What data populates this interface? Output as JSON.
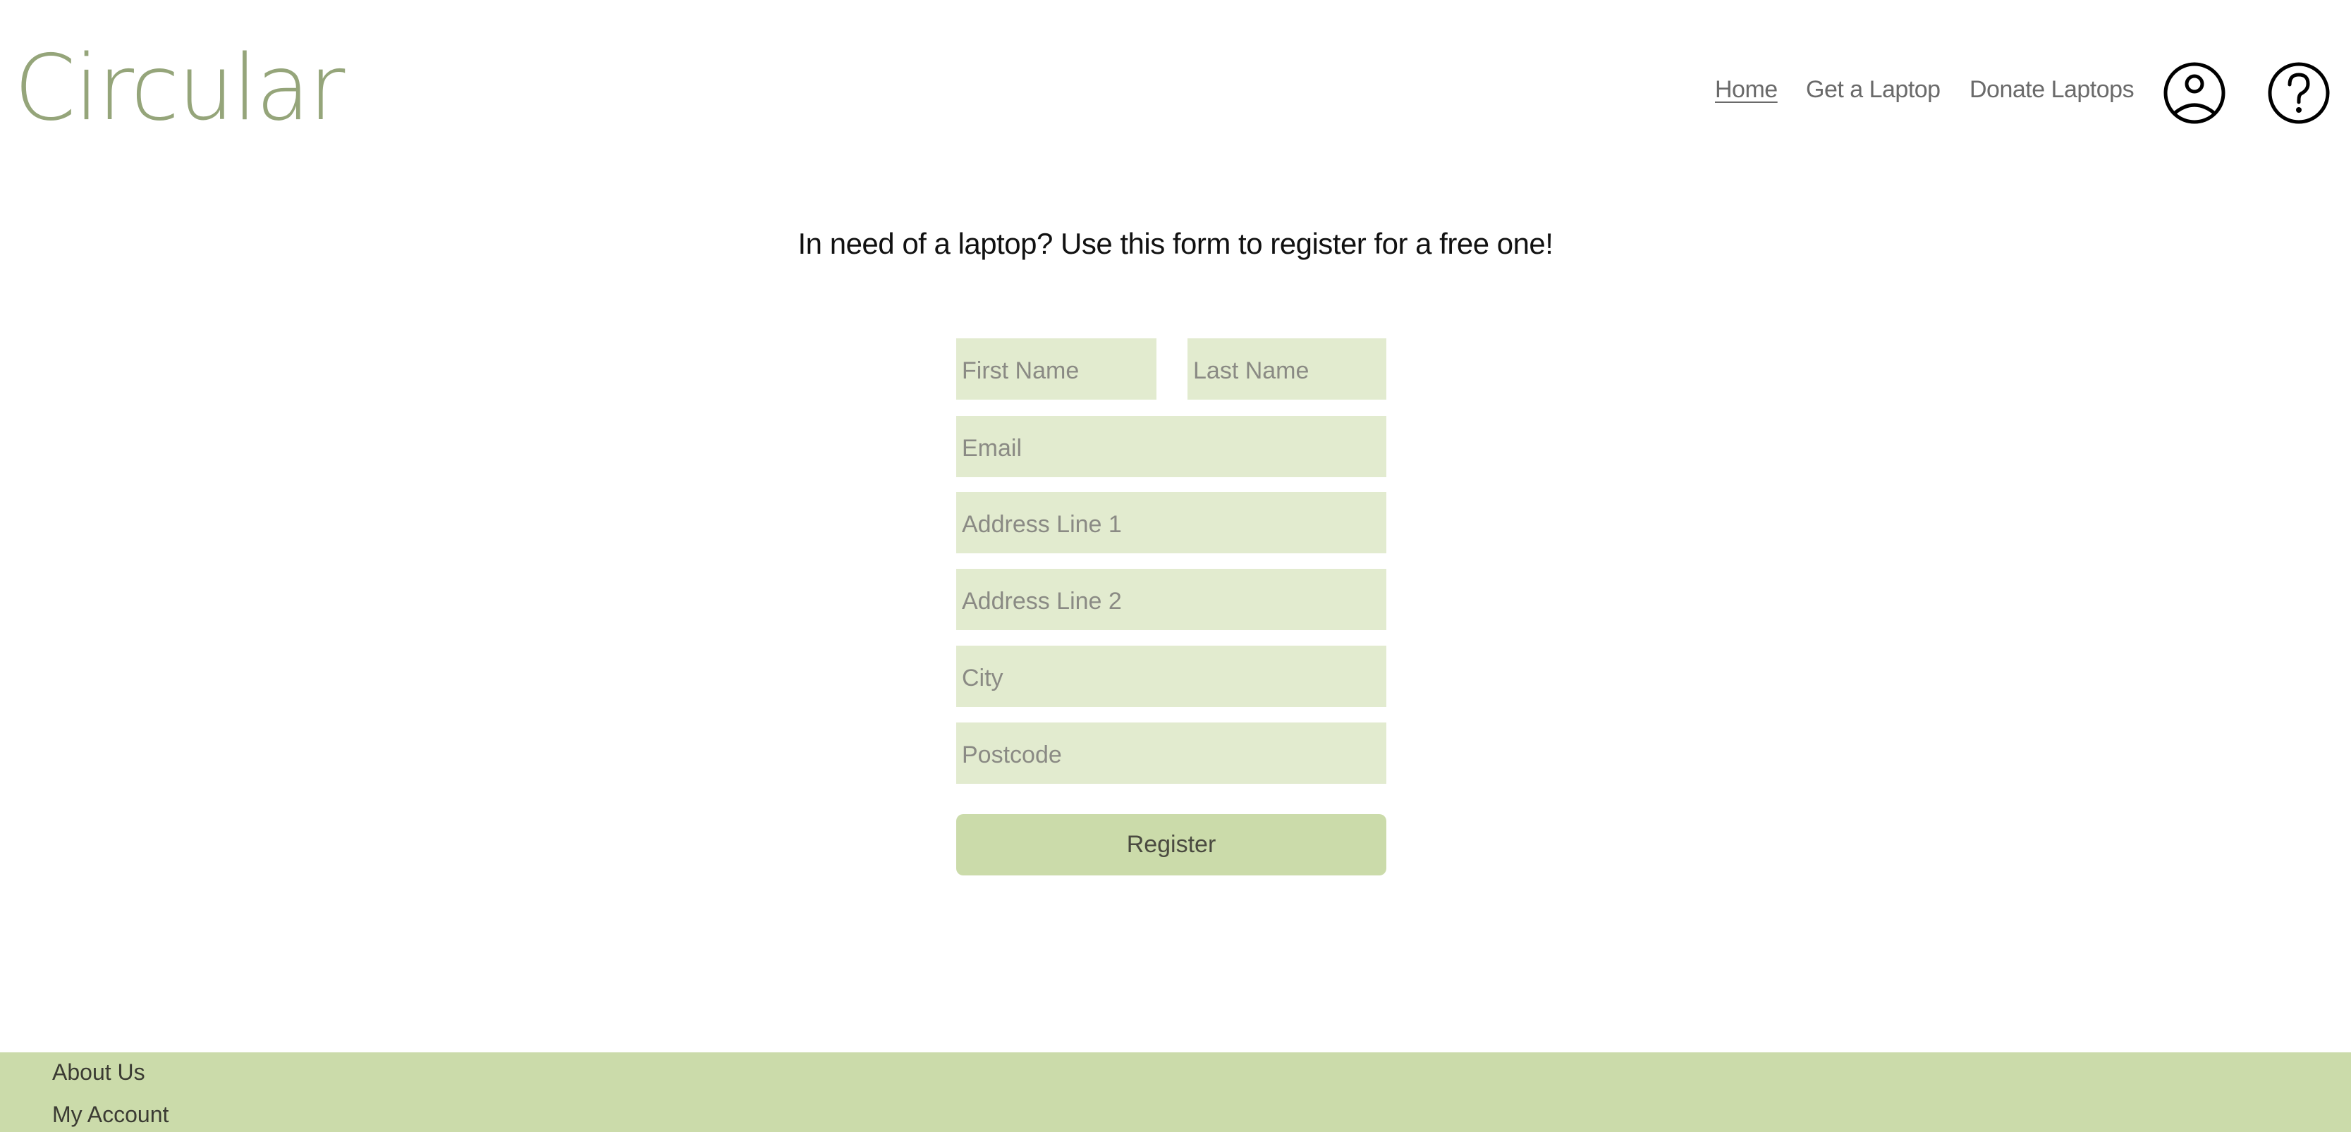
{
  "header": {
    "logo_text": "Circular",
    "nav": [
      {
        "label": "Home",
        "active": true
      },
      {
        "label": "Get a Laptop",
        "active": false
      },
      {
        "label": "Donate Laptops",
        "active": false
      }
    ],
    "icons": [
      "account-icon",
      "help-icon"
    ]
  },
  "main": {
    "headline": "In need of a laptop? Use this form to register for a free one!",
    "form": {
      "first_name": {
        "placeholder": "First Name",
        "value": ""
      },
      "last_name": {
        "placeholder": "Last Name",
        "value": ""
      },
      "email": {
        "placeholder": "Email",
        "value": ""
      },
      "address1": {
        "placeholder": "Address Line 1",
        "value": ""
      },
      "address2": {
        "placeholder": "Address Line 2",
        "value": ""
      },
      "city": {
        "placeholder": "City",
        "value": ""
      },
      "postcode": {
        "placeholder": "Postcode",
        "value": ""
      },
      "submit_label": "Register"
    }
  },
  "footer": {
    "links": [
      "About Us",
      "My Account"
    ]
  },
  "colors": {
    "brand": "#95a57a",
    "field_bg": "#e2ebcf",
    "button_bg": "#cbdbaa",
    "footer_bg": "#cbdbaa"
  }
}
